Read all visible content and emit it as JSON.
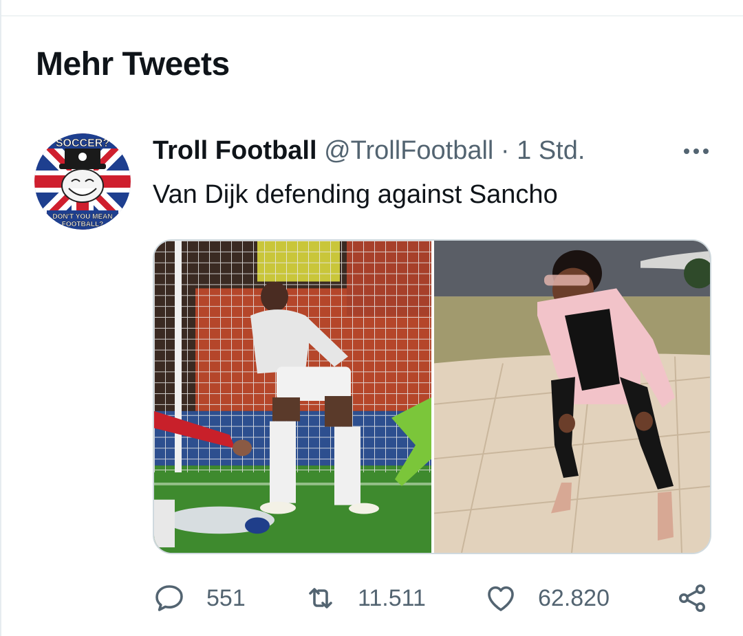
{
  "section": {
    "title": "Mehr Tweets"
  },
  "tweet": {
    "author_name": "Troll Football",
    "author_handle": "@TrollFootball",
    "separator": "·",
    "timestamp": "1 Std.",
    "text": "Van Dijk defending against Sancho",
    "avatar": {
      "top_text": "SOCCER?",
      "bottom_text_1": "DON'T YOU MEAN",
      "bottom_text_2": "FOOTBALL?"
    },
    "stats": {
      "replies": "551",
      "retweets": "11.511",
      "likes": "62.820"
    }
  },
  "colors": {
    "text": "#0f1419",
    "secondary": "#536471",
    "border": "#cfd9de"
  },
  "icons": {
    "reply": "reply-icon",
    "retweet": "retweet-icon",
    "like": "heart-icon",
    "share": "share-icon",
    "more": "more-icon"
  }
}
